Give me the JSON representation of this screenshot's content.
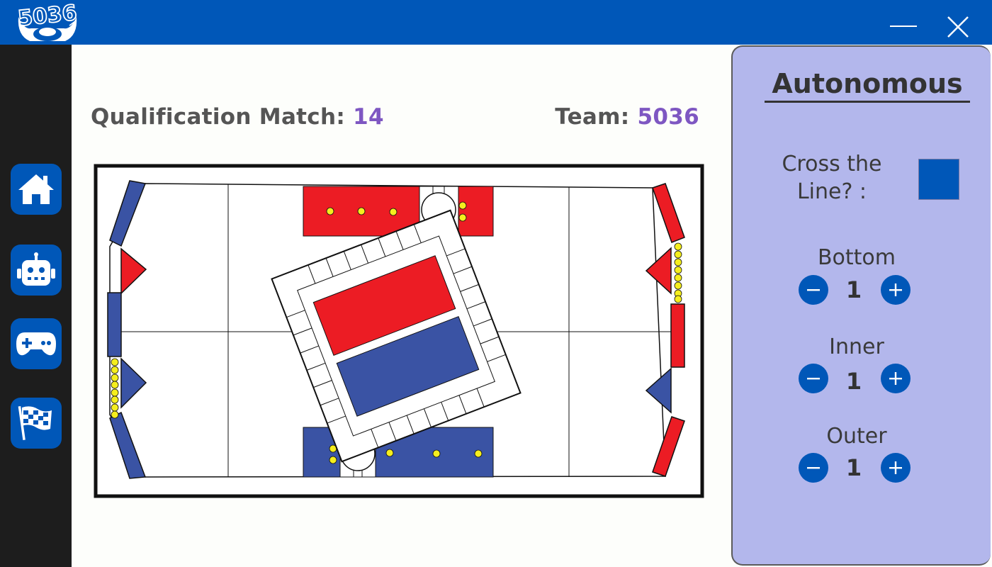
{
  "app": {
    "logo_text": "5036",
    "accent_color": "#0057b8",
    "highlight_color": "#7e57c2",
    "panel_color": "#b3b7ec"
  },
  "window_controls": [
    {
      "name": "minimize",
      "icon": "minimize-icon"
    },
    {
      "name": "close",
      "icon": "close-icon"
    }
  ],
  "sidebar": {
    "items": [
      {
        "name": "home",
        "icon": "home-icon"
      },
      {
        "name": "autonomous",
        "icon": "robot-icon"
      },
      {
        "name": "teleop",
        "icon": "gamepad-icon"
      },
      {
        "name": "endgame",
        "icon": "checkered-flag-icon"
      }
    ]
  },
  "header": {
    "match_label": "Qualification Match: ",
    "match_number": "14",
    "team_label": "Team: ",
    "team_number": "5036"
  },
  "field": {
    "icon": "field-map",
    "colors": {
      "red": "#ec1c24",
      "blue": "#3a53a4",
      "ball": "#f5ee1e"
    }
  },
  "panel": {
    "title": "Autonomous",
    "cross_line_label": "Cross the Line? :",
    "cross_line_checked": true,
    "counters": [
      {
        "label": "Bottom",
        "value": "1"
      },
      {
        "label": "Inner",
        "value": "1"
      },
      {
        "label": "Outer",
        "value": "1"
      }
    ]
  }
}
